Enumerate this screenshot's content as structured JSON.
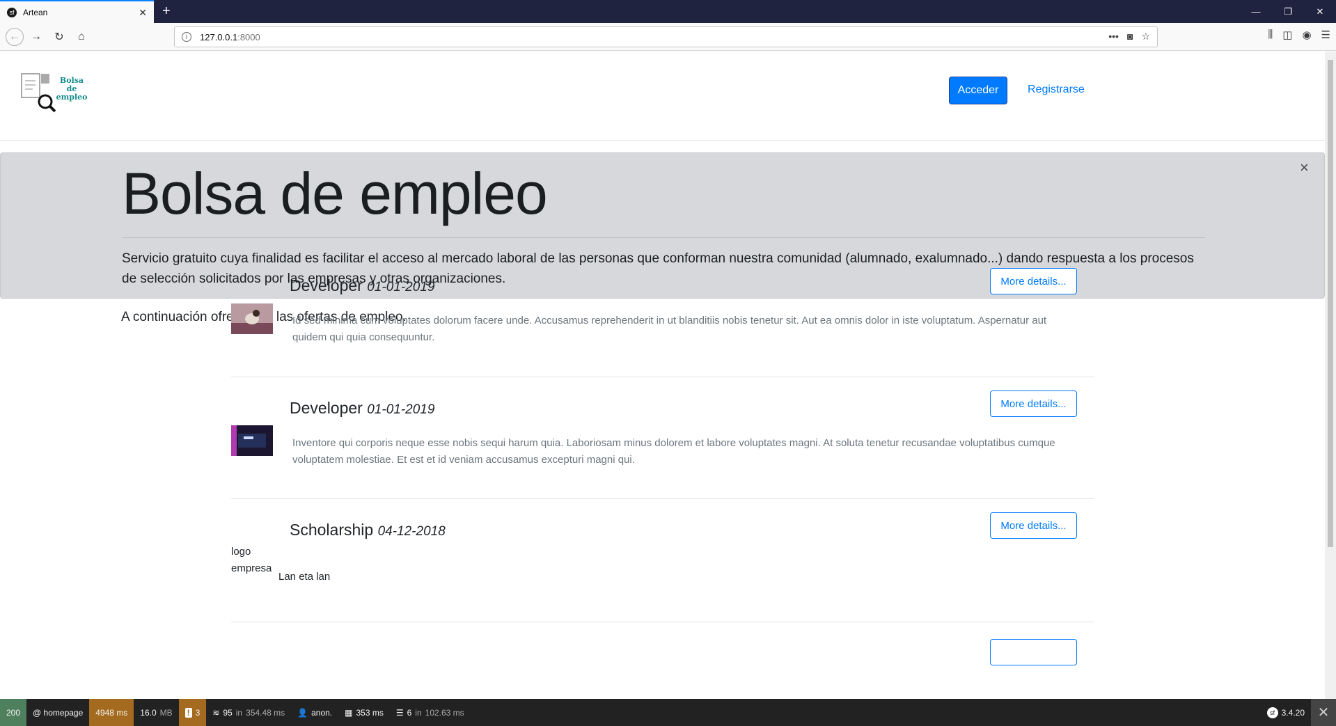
{
  "browser": {
    "tab_title": "Artean",
    "url_host": "127.0.0.1",
    "url_port": ":8000"
  },
  "header": {
    "logo_line1": "Bolsa de",
    "logo_line2": "empleo",
    "login_label": "Acceder",
    "register_label": "Registrarse"
  },
  "jumbotron": {
    "title": "Bolsa de empleo",
    "text": "Servicio gratuito cuya finalidad es facilitar el acceso al mercado laboral de las personas que conforman nuestra comunidad (alumnado, exalumnado...) dando respuesta a los procesos de selección solicitados por las empresas y otras organizaciones.",
    "close_glyph": "×"
  },
  "intro": "A continuación ofrecemos las ofertas de empleo.",
  "offers": [
    {
      "title": "Developer",
      "date": "01-01-2019",
      "description": "Id sed minima cum voluptates dolorum facere unde. Accusamus reprehenderit in ut blanditiis nobis tenetur sit. Aut ea omnis dolor in iste voluptatum. Aspernatur aut quidem qui quia consequuntur.",
      "button": "More details..."
    },
    {
      "title": "Developer",
      "date": "01-01-2019",
      "description": "Inventore qui corporis neque esse nobis sequi harum quia. Laboriosam minus dolorem et labore voluptates magni. At soluta tenetur recusandae voluptatibus cumque voluptatem molestiae. Et est et id veniam accusamus excepturi magni qui.",
      "button": "More details..."
    },
    {
      "title": "Scholarship",
      "date": "04-12-2018",
      "alt_logo_line1": "logo",
      "alt_logo_line2": "empresa",
      "description": "Lan eta lan",
      "button": "More details..."
    }
  ],
  "debugbar": {
    "status": "200",
    "route": "@ homepage",
    "time": "4948 ms",
    "memory": "16.0",
    "memory_unit": "MB",
    "warnings": "3",
    "events_count": "95",
    "events_in": "in",
    "events_time": "354.48 ms",
    "user": "anon.",
    "twig_time": "353 ms",
    "db_count": "6",
    "db_in": "in",
    "db_time": "102.63 ms",
    "version": "3.4.20"
  }
}
